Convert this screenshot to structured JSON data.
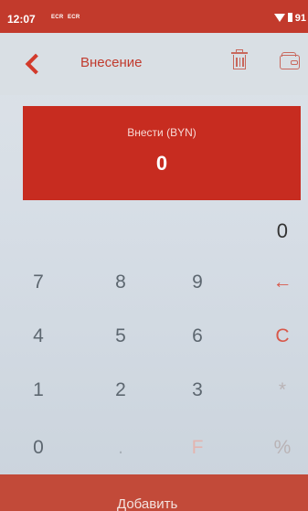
{
  "status_bar": {
    "time": "12:07",
    "indicators": [
      "ECR",
      "ECR"
    ],
    "battery": "91"
  },
  "header": {
    "title": "Внесение",
    "icons": [
      "back-arrow-icon",
      "trash-icon",
      "wallet-icon"
    ]
  },
  "amount_panel": {
    "label": "Внести (BYN)",
    "value": "0"
  },
  "entry_display": "0",
  "keypad": {
    "row1": [
      "7",
      "8",
      "9",
      "←"
    ],
    "row2": [
      "4",
      "5",
      "6",
      "C"
    ],
    "row3": [
      "1",
      "2",
      "3",
      "*"
    ],
    "row4": [
      "0",
      ".",
      "F",
      "%"
    ]
  },
  "add_button": {
    "label": "Добавить"
  },
  "colors": {
    "brand_red": "#c72c20",
    "accent_red": "#d23a2b",
    "background": "#d9dfe4"
  }
}
